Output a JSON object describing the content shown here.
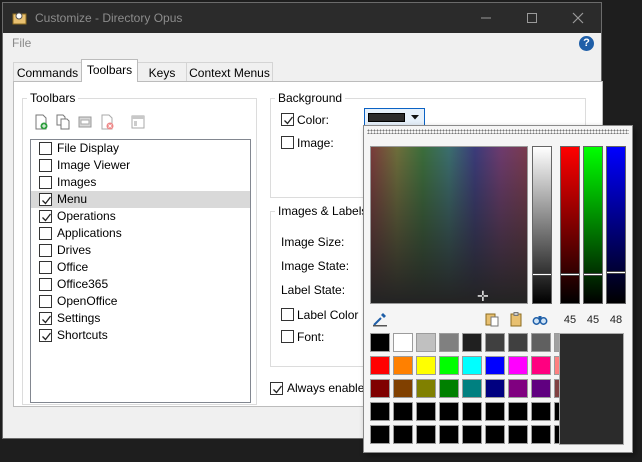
{
  "window": {
    "title": "Customize - Directory Opus"
  },
  "menubar": {
    "file": "File",
    "help_icon": "?"
  },
  "tabs": [
    {
      "label": "Commands",
      "active": false
    },
    {
      "label": "Toolbars",
      "active": true
    },
    {
      "label": "Keys",
      "active": false
    },
    {
      "label": "Context Menus",
      "active": false
    }
  ],
  "toolbars_panel": {
    "heading": "Toolbars",
    "icons": [
      "new-toolbar-icon",
      "copy-toolbar-icon",
      "save-toolbar-icon",
      "delete-toolbar-icon",
      "properties-icon"
    ],
    "items": [
      {
        "label": "File Display",
        "checked": false
      },
      {
        "label": "Image Viewer",
        "checked": false
      },
      {
        "label": "Images",
        "checked": false
      },
      {
        "label": "Menu",
        "checked": true,
        "selected": true
      },
      {
        "label": "Operations",
        "checked": true
      },
      {
        "label": "Applications",
        "checked": false
      },
      {
        "label": "Drives",
        "checked": false
      },
      {
        "label": "Office",
        "checked": false
      },
      {
        "label": "Office365",
        "checked": false
      },
      {
        "label": "OpenOffice",
        "checked": false
      },
      {
        "label": "Settings",
        "checked": true
      },
      {
        "label": "Shortcuts",
        "checked": true
      }
    ]
  },
  "background": {
    "heading": "Background",
    "color_label": "Color:",
    "color_checked": true,
    "image_label": "Image:",
    "image_checked": false,
    "color_value": "#2b2b2b"
  },
  "images_labels": {
    "heading": "Images & Labels",
    "image_size": "Image Size:",
    "image_state": "Image State:",
    "label_state": "Label State:",
    "label_color": "Label Color",
    "font": "Font:"
  },
  "always_enable": {
    "label": "Always enable f",
    "checked": true
  },
  "color_picker": {
    "rgb": {
      "r": 45,
      "g": 45,
      "b": 48
    },
    "slider_levels": {
      "gray": 0.18,
      "red": 0.18,
      "green": 0.18,
      "blue": 0.19
    },
    "current_color": "#2b2b2b",
    "swatches": [
      [
        "#000000",
        "#ffffff",
        "#c0c0c0",
        "#808080",
        "#202020",
        "#404040",
        "#404040",
        "#606060",
        "#a0a0a0"
      ],
      [
        "#ff0000",
        "#ff8000",
        "#ffff00",
        "#00ff00",
        "#00ffff",
        "#0000ff",
        "#ff00ff",
        "#ff0080",
        "#ff8080"
      ],
      [
        "#800000",
        "#804000",
        "#808000",
        "#008000",
        "#008080",
        "#000080",
        "#800080",
        "#600080",
        "#804040"
      ],
      [
        "#000000",
        "#000000",
        "#000000",
        "#000000",
        "#000000",
        "#000000",
        "#000000",
        "#000000",
        "#000000"
      ],
      [
        "#000000",
        "#000000",
        "#000000",
        "#000000",
        "#000000",
        "#000000",
        "#000000",
        "#000000",
        "#000000"
      ]
    ]
  }
}
